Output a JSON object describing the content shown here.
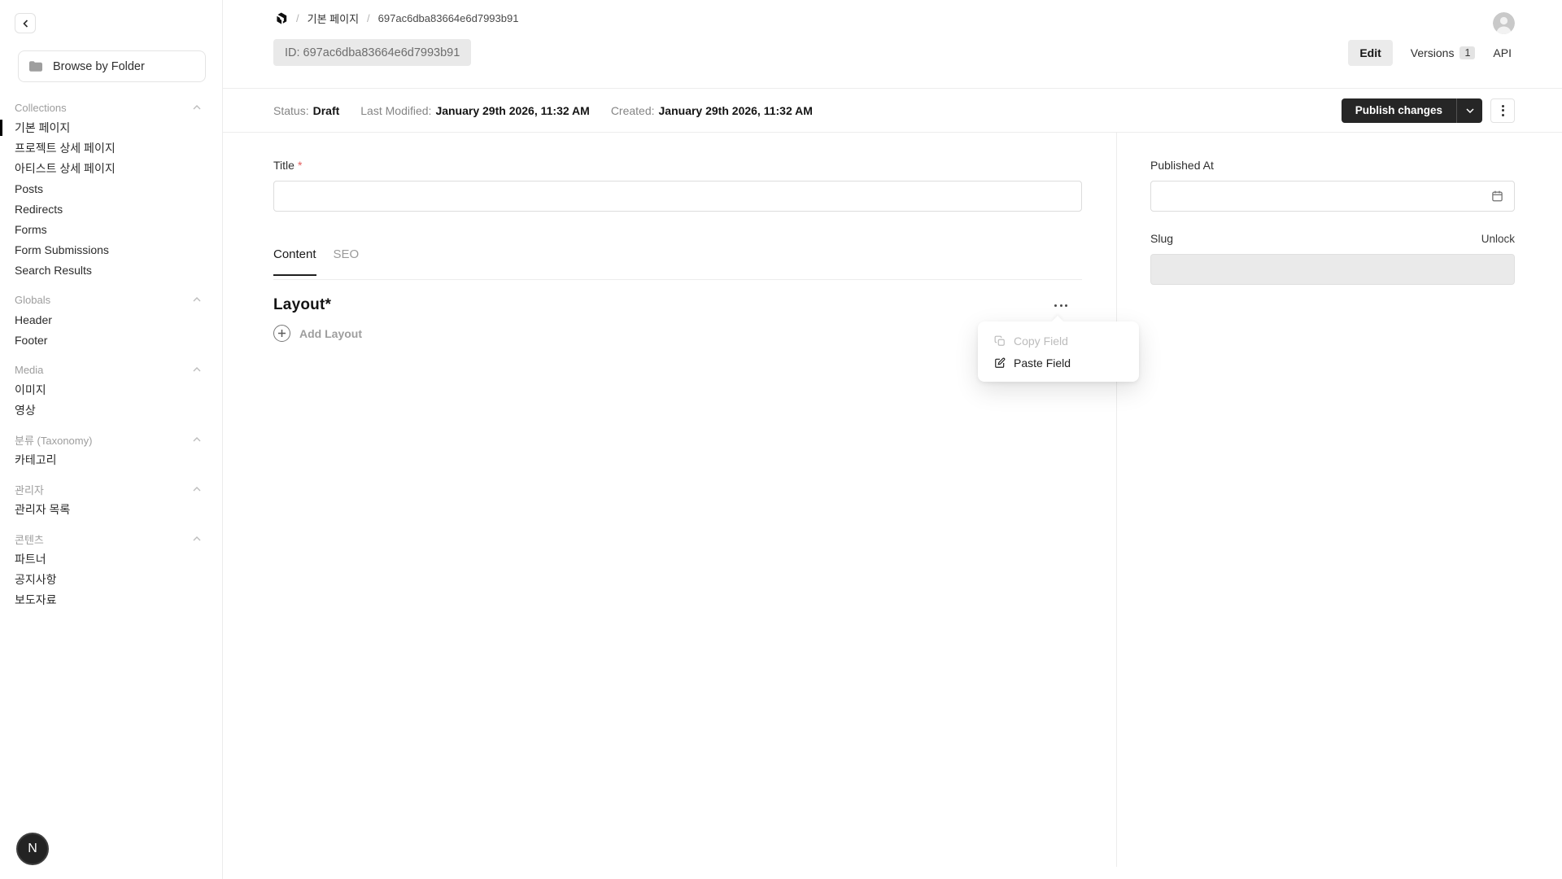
{
  "sidebar": {
    "browse_button": "Browse by Folder",
    "sections": [
      {
        "label": "Collections",
        "items": [
          {
            "label": "기본 페이지"
          },
          {
            "label": "프로젝트 상세 페이지"
          },
          {
            "label": "아티스트 상세 페이지"
          },
          {
            "label": "Posts"
          },
          {
            "label": "Redirects"
          },
          {
            "label": "Forms"
          },
          {
            "label": "Form Submissions"
          },
          {
            "label": "Search Results"
          }
        ]
      },
      {
        "label": "Globals",
        "items": [
          {
            "label": "Header"
          },
          {
            "label": "Footer"
          }
        ]
      },
      {
        "label": "Media",
        "items": [
          {
            "label": "이미지"
          },
          {
            "label": "영상"
          }
        ]
      },
      {
        "label": "분류 (Taxonomy)",
        "items": [
          {
            "label": "카테고리"
          }
        ]
      },
      {
        "label": "관리자",
        "items": [
          {
            "label": "관리자 목록"
          }
        ]
      },
      {
        "label": "콘텐츠",
        "items": [
          {
            "label": "파트너"
          },
          {
            "label": "공지사항"
          },
          {
            "label": "보도자료"
          }
        ]
      }
    ],
    "avatar_initial": "N"
  },
  "header": {
    "breadcrumb": {
      "separator": "/",
      "collection": "기본 페이지",
      "document_id": "697ac6dba83664e6d7993b91"
    },
    "id_pill": "ID: 697ac6dba83664e6d7993b91",
    "tabs": {
      "edit": "Edit",
      "versions": "Versions",
      "versions_count": "1",
      "api": "API"
    }
  },
  "statusbar": {
    "status_label": "Status:",
    "status_value": "Draft",
    "modified_label": "Last Modified:",
    "modified_value": "January 29th 2026, 11:32 AM",
    "created_label": "Created:",
    "created_value": "January 29th 2026, 11:32 AM",
    "publish_button": "Publish changes"
  },
  "form": {
    "title_label": "Title",
    "required_mark": "*",
    "title_value": "",
    "tabs": {
      "content": "Content",
      "seo": "SEO"
    },
    "layout_heading": "Layout*",
    "add_layout_label": "Add Layout",
    "field_menu": {
      "copy_label": "Copy Field",
      "paste_label": "Paste Field"
    }
  },
  "side_fields": {
    "published_at_label": "Published At",
    "published_at_value": "",
    "slug_label": "Slug",
    "unlock_label": "Unlock"
  },
  "icons": {
    "back": "chevron-left",
    "folder": "folder",
    "section_collapse": "chevron-up",
    "logo": "payload-logo",
    "user": "person-circle",
    "publish_caret": "chevron-down",
    "more_horizontal": "ellipsis",
    "more_vertical": "kebab",
    "add": "plus-circle",
    "copy": "copy",
    "paste": "edit-square",
    "calendar": "calendar"
  },
  "colors": {
    "accent_dark_button": "#262626",
    "required_red": "#e35c5c",
    "pill_bg": "#e9e9e9",
    "active_tab_bg": "#ebebeb",
    "border": "#ececec",
    "muted_text": "#9d9d9d",
    "avatar_dark": "#232323",
    "avatar_gray": "#c9c9c9"
  }
}
